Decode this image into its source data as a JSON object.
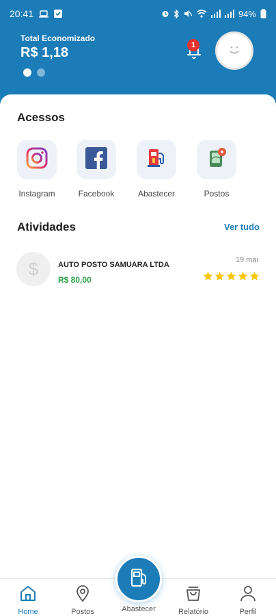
{
  "status_bar": {
    "time": "20:41",
    "battery": "94%"
  },
  "header": {
    "total_label": "Total Economizado",
    "total_value": "R$ 1,18",
    "notification_count": "1",
    "carousel_page": 1,
    "carousel_pages": 2
  },
  "acessos": {
    "title": "Acessos",
    "items": [
      {
        "label": "Instagram",
        "icon": "instagram-icon"
      },
      {
        "label": "Facebook",
        "icon": "facebook-icon"
      },
      {
        "label": "Abastecer",
        "icon": "fuel-pump-icon"
      },
      {
        "label": "Postos",
        "icon": "map-pin-icon"
      }
    ]
  },
  "atividades": {
    "title": "Atividades",
    "see_all": "Ver tudo",
    "items": [
      {
        "name": "AUTO POSTO SAMUARA LTDA",
        "amount": "R$ 80,00",
        "date": "19 mai",
        "rating": 5
      }
    ]
  },
  "nav": {
    "items": [
      {
        "label": "Home",
        "icon": "home-icon",
        "active": true
      },
      {
        "label": "Postos",
        "icon": "location-icon",
        "active": false
      },
      {
        "label": "Abastecer",
        "icon": "fuel-pump-icon",
        "active": false
      },
      {
        "label": "Relatório",
        "icon": "shopping-bag-icon",
        "active": false
      },
      {
        "label": "Perfil",
        "icon": "person-icon",
        "active": false
      }
    ]
  },
  "colors": {
    "primary": "#1b7cb8",
    "accent_green": "#2aa14a",
    "star": "#f7c600",
    "badge_red": "#e5322d"
  }
}
